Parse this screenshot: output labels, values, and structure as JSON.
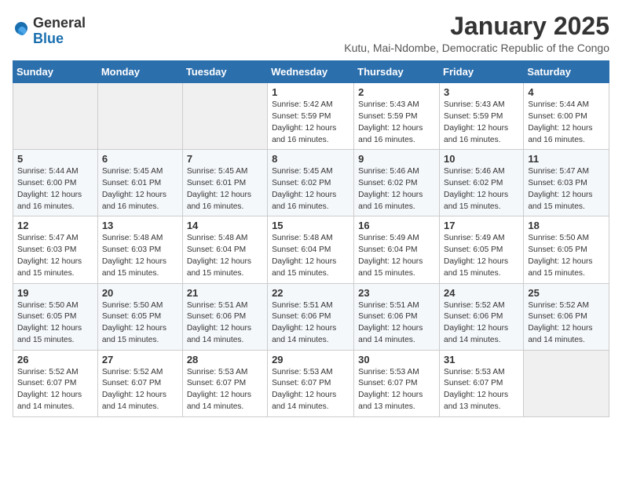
{
  "logo": {
    "general": "General",
    "blue": "Blue"
  },
  "title": "January 2025",
  "subtitle": "Kutu, Mai-Ndombe, Democratic Republic of the Congo",
  "weekdays": [
    "Sunday",
    "Monday",
    "Tuesday",
    "Wednesday",
    "Thursday",
    "Friday",
    "Saturday"
  ],
  "weeks": [
    [
      {
        "day": "",
        "info": ""
      },
      {
        "day": "",
        "info": ""
      },
      {
        "day": "",
        "info": ""
      },
      {
        "day": "1",
        "info": "Sunrise: 5:42 AM\nSunset: 5:59 PM\nDaylight: 12 hours and 16 minutes."
      },
      {
        "day": "2",
        "info": "Sunrise: 5:43 AM\nSunset: 5:59 PM\nDaylight: 12 hours and 16 minutes."
      },
      {
        "day": "3",
        "info": "Sunrise: 5:43 AM\nSunset: 5:59 PM\nDaylight: 12 hours and 16 minutes."
      },
      {
        "day": "4",
        "info": "Sunrise: 5:44 AM\nSunset: 6:00 PM\nDaylight: 12 hours and 16 minutes."
      }
    ],
    [
      {
        "day": "5",
        "info": "Sunrise: 5:44 AM\nSunset: 6:00 PM\nDaylight: 12 hours and 16 minutes."
      },
      {
        "day": "6",
        "info": "Sunrise: 5:45 AM\nSunset: 6:01 PM\nDaylight: 12 hours and 16 minutes."
      },
      {
        "day": "7",
        "info": "Sunrise: 5:45 AM\nSunset: 6:01 PM\nDaylight: 12 hours and 16 minutes."
      },
      {
        "day": "8",
        "info": "Sunrise: 5:45 AM\nSunset: 6:02 PM\nDaylight: 12 hours and 16 minutes."
      },
      {
        "day": "9",
        "info": "Sunrise: 5:46 AM\nSunset: 6:02 PM\nDaylight: 12 hours and 16 minutes."
      },
      {
        "day": "10",
        "info": "Sunrise: 5:46 AM\nSunset: 6:02 PM\nDaylight: 12 hours and 15 minutes."
      },
      {
        "day": "11",
        "info": "Sunrise: 5:47 AM\nSunset: 6:03 PM\nDaylight: 12 hours and 15 minutes."
      }
    ],
    [
      {
        "day": "12",
        "info": "Sunrise: 5:47 AM\nSunset: 6:03 PM\nDaylight: 12 hours and 15 minutes."
      },
      {
        "day": "13",
        "info": "Sunrise: 5:48 AM\nSunset: 6:03 PM\nDaylight: 12 hours and 15 minutes."
      },
      {
        "day": "14",
        "info": "Sunrise: 5:48 AM\nSunset: 6:04 PM\nDaylight: 12 hours and 15 minutes."
      },
      {
        "day": "15",
        "info": "Sunrise: 5:48 AM\nSunset: 6:04 PM\nDaylight: 12 hours and 15 minutes."
      },
      {
        "day": "16",
        "info": "Sunrise: 5:49 AM\nSunset: 6:04 PM\nDaylight: 12 hours and 15 minutes."
      },
      {
        "day": "17",
        "info": "Sunrise: 5:49 AM\nSunset: 6:05 PM\nDaylight: 12 hours and 15 minutes."
      },
      {
        "day": "18",
        "info": "Sunrise: 5:50 AM\nSunset: 6:05 PM\nDaylight: 12 hours and 15 minutes."
      }
    ],
    [
      {
        "day": "19",
        "info": "Sunrise: 5:50 AM\nSunset: 6:05 PM\nDaylight: 12 hours and 15 minutes."
      },
      {
        "day": "20",
        "info": "Sunrise: 5:50 AM\nSunset: 6:05 PM\nDaylight: 12 hours and 15 minutes."
      },
      {
        "day": "21",
        "info": "Sunrise: 5:51 AM\nSunset: 6:06 PM\nDaylight: 12 hours and 14 minutes."
      },
      {
        "day": "22",
        "info": "Sunrise: 5:51 AM\nSunset: 6:06 PM\nDaylight: 12 hours and 14 minutes."
      },
      {
        "day": "23",
        "info": "Sunrise: 5:51 AM\nSunset: 6:06 PM\nDaylight: 12 hours and 14 minutes."
      },
      {
        "day": "24",
        "info": "Sunrise: 5:52 AM\nSunset: 6:06 PM\nDaylight: 12 hours and 14 minutes."
      },
      {
        "day": "25",
        "info": "Sunrise: 5:52 AM\nSunset: 6:06 PM\nDaylight: 12 hours and 14 minutes."
      }
    ],
    [
      {
        "day": "26",
        "info": "Sunrise: 5:52 AM\nSunset: 6:07 PM\nDaylight: 12 hours and 14 minutes."
      },
      {
        "day": "27",
        "info": "Sunrise: 5:52 AM\nSunset: 6:07 PM\nDaylight: 12 hours and 14 minutes."
      },
      {
        "day": "28",
        "info": "Sunrise: 5:53 AM\nSunset: 6:07 PM\nDaylight: 12 hours and 14 minutes."
      },
      {
        "day": "29",
        "info": "Sunrise: 5:53 AM\nSunset: 6:07 PM\nDaylight: 12 hours and 14 minutes."
      },
      {
        "day": "30",
        "info": "Sunrise: 5:53 AM\nSunset: 6:07 PM\nDaylight: 12 hours and 13 minutes."
      },
      {
        "day": "31",
        "info": "Sunrise: 5:53 AM\nSunset: 6:07 PM\nDaylight: 12 hours and 13 minutes."
      },
      {
        "day": "",
        "info": ""
      }
    ]
  ]
}
